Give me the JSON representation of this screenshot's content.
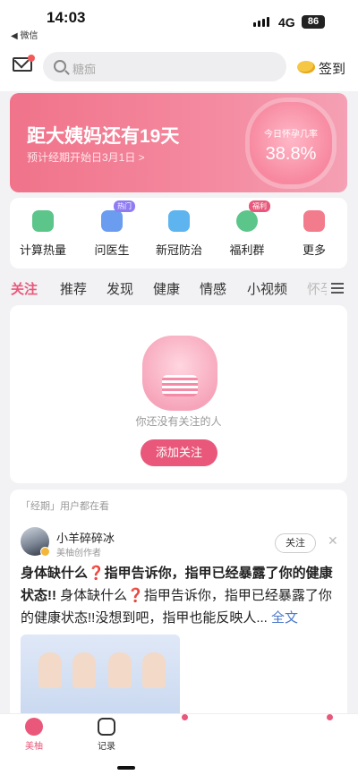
{
  "status_bar": {
    "time": "14:03",
    "back_app": "◀ 微信",
    "network": "4G",
    "battery": "86"
  },
  "header": {
    "search_placeholder": "糖痂",
    "checkin_label": "签到"
  },
  "banner": {
    "title": "距大姨妈还有19天",
    "subtitle": "预计经期开始日3月1日 >",
    "pregnancy_label": "今日怀孕几率",
    "pregnancy_value": "38.8%"
  },
  "quick_actions": [
    {
      "label": "计算热量",
      "icon": "calculator-icon",
      "color": "#5cc58a"
    },
    {
      "label": "问医生",
      "icon": "doctor-icon",
      "color": "#6a9cf0",
      "badge": "热门"
    },
    {
      "label": "新冠防治",
      "icon": "shield-icon",
      "color": "#5db4ef"
    },
    {
      "label": "福利群",
      "icon": "chat-group-icon",
      "color": "#5cc58a",
      "badge": "福利"
    },
    {
      "label": "更多",
      "icon": "grid-icon",
      "color": "#f27b8c"
    }
  ],
  "tabs": [
    "关注",
    "推荐",
    "发现",
    "健康",
    "情感",
    "小视频",
    "怀孕"
  ],
  "active_tab": "关注",
  "empty_state": {
    "message": "你还没有关注的人",
    "button": "添加关注"
  },
  "feed": {
    "hint": "「经期」用户都在看",
    "author_name": "小羊碎碎冰",
    "author_role": "美柚创作者",
    "follow_label": "关注",
    "post_title": "身体缺什么❓指甲告诉你，指甲已经暴露了你的健康状态!!",
    "post_text": " 身体缺什么❓指甲告诉你，指甲已经暴露了你的健康状态!!没想到吧，指甲也能反映人...",
    "more_label": " 全文"
  },
  "bottom_nav": [
    {
      "label": "美柚",
      "icon": "meiyou-icon",
      "active": true
    },
    {
      "label": "记录",
      "icon": "calendar-icon",
      "active": false
    }
  ],
  "colors": {
    "accent": "#e9587a",
    "banner": "#f0738a",
    "link": "#4a78c9"
  }
}
